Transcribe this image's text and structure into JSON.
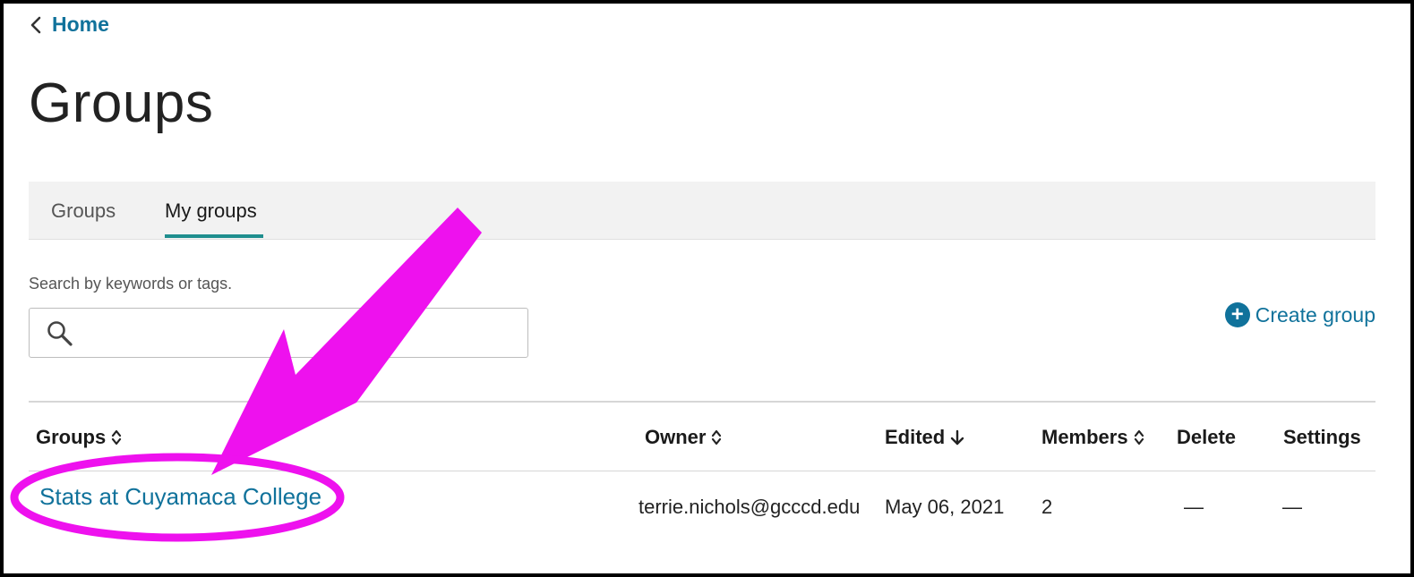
{
  "nav": {
    "back_label": "Home"
  },
  "page": {
    "title": "Groups"
  },
  "tabs": [
    {
      "label": "Groups",
      "active": false
    },
    {
      "label": "My groups",
      "active": true
    }
  ],
  "search": {
    "label": "Search by keywords or tags.",
    "value": "",
    "placeholder": ""
  },
  "actions": {
    "create_group_label": "Create group"
  },
  "table": {
    "columns": [
      {
        "label": "Groups",
        "sort": "both"
      },
      {
        "label": "Owner",
        "sort": "both"
      },
      {
        "label": "Edited",
        "sort": "desc"
      },
      {
        "label": "Members",
        "sort": "both"
      },
      {
        "label": "Delete",
        "sort": "none"
      },
      {
        "label": "Settings",
        "sort": "none"
      }
    ],
    "rows": [
      {
        "name": "Stats at Cuyamaca College",
        "owner": "terrie.nichols@gcccd.edu",
        "edited": "May 06, 2021",
        "members": "2",
        "delete": "—",
        "settings": "—"
      }
    ]
  },
  "icons": {
    "back": "chevron-left-icon",
    "search": "magnifier-icon",
    "create": "plus-circle-icon",
    "sort_both": "sort-updown-icon",
    "sort_desc": "arrow-down-icon"
  },
  "colors": {
    "link": "#10729b",
    "tab_underline": "#1f8e8e",
    "annotation": "#ee11ee"
  }
}
